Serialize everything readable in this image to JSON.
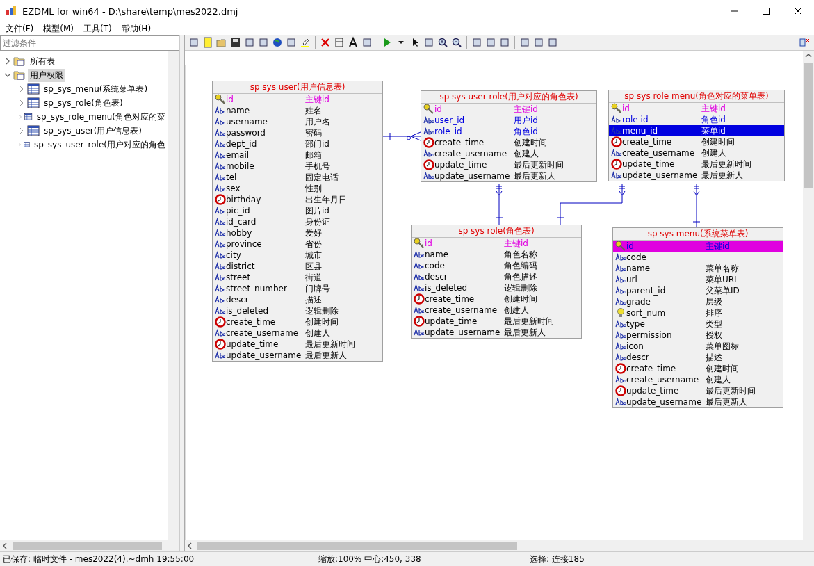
{
  "window": {
    "title": "EZDML for win64 - D:\\share\\temp\\mes2022.dmj"
  },
  "menu": [
    "文件(F)",
    "模型(M)",
    "工具(T)",
    "帮助(H)"
  ],
  "filter": {
    "placeholder": "过滤条件"
  },
  "tree": [
    {
      "label": "所有表",
      "expanded": false,
      "selected": false
    },
    {
      "label": "用户权限",
      "expanded": true,
      "selected": true,
      "children": [
        {
          "label": "sp_sys_menu(系统菜单表)"
        },
        {
          "label": "sp_sys_role(角色表)"
        },
        {
          "label": "sp_sys_role_menu(角色对应的菜"
        },
        {
          "label": "sp_sys_user(用户信息表)"
        },
        {
          "label": "sp_sys_user_role(用户对应的角色"
        }
      ]
    }
  ],
  "tables": [
    {
      "title": "sp sys user(用户信息表)",
      "fields": [
        {
          "kind": "key",
          "name": "id",
          "comment": "主键id",
          "color": "#e000e0",
          "selected": false
        },
        {
          "kind": "text",
          "name": "name",
          "comment": "姓名",
          "selected": false
        },
        {
          "kind": "text",
          "name": "username",
          "comment": "用户名",
          "selected": false
        },
        {
          "kind": "text",
          "name": "password",
          "comment": "密码",
          "selected": false
        },
        {
          "kind": "text",
          "name": "dept_id",
          "comment": "部门id",
          "selected": false
        },
        {
          "kind": "text",
          "name": "email",
          "comment": "邮箱",
          "selected": false
        },
        {
          "kind": "text",
          "name": "mobile",
          "comment": "手机号",
          "selected": false
        },
        {
          "kind": "text",
          "name": "tel",
          "comment": "固定电话",
          "selected": false
        },
        {
          "kind": "text",
          "name": "sex",
          "comment": "性别",
          "selected": false
        },
        {
          "kind": "clock",
          "name": "birthday",
          "comment": "出生年月日",
          "selected": false
        },
        {
          "kind": "text",
          "name": "pic_id",
          "comment": "图片id",
          "selected": false
        },
        {
          "kind": "text",
          "name": "id_card",
          "comment": "身份证",
          "selected": false
        },
        {
          "kind": "text",
          "name": "hobby",
          "comment": "爱好",
          "selected": false
        },
        {
          "kind": "text",
          "name": "province",
          "comment": "省份",
          "selected": false
        },
        {
          "kind": "text",
          "name": "city",
          "comment": "城市",
          "selected": false
        },
        {
          "kind": "text",
          "name": "district",
          "comment": "区县",
          "selected": false
        },
        {
          "kind": "text",
          "name": "street",
          "comment": "街道",
          "selected": false
        },
        {
          "kind": "text",
          "name": "street_number",
          "comment": "门牌号",
          "selected": false
        },
        {
          "kind": "text",
          "name": "descr",
          "comment": "描述",
          "selected": false
        },
        {
          "kind": "text",
          "name": "is_deleted",
          "comment": "逻辑删除",
          "selected": false
        },
        {
          "kind": "clock",
          "name": "create_time",
          "comment": "创建时间",
          "selected": false
        },
        {
          "kind": "text",
          "name": "create_username",
          "comment": "创建人",
          "selected": false
        },
        {
          "kind": "clock",
          "name": "update_time",
          "comment": "最后更新时间",
          "selected": false
        },
        {
          "kind": "text",
          "name": "update_username",
          "comment": "最后更新人",
          "selected": false
        }
      ]
    },
    {
      "title": "sp sys user role(用户对应的角色表)",
      "fields": [
        {
          "kind": "key",
          "name": "id",
          "comment": "主键id",
          "color": "#e000e0",
          "selected": false
        },
        {
          "kind": "text",
          "name": "user_id",
          "comment": "用户id",
          "color": "#0000e0",
          "selected": false
        },
        {
          "kind": "text",
          "name": "role_id",
          "comment": "角色id",
          "color": "#0000e0",
          "selected": false
        },
        {
          "kind": "clock",
          "name": "create_time",
          "comment": "创建时间",
          "selected": false
        },
        {
          "kind": "text",
          "name": "create_username",
          "comment": "创建人",
          "selected": false
        },
        {
          "kind": "clock",
          "name": "update_time",
          "comment": "最后更新时间",
          "selected": false
        },
        {
          "kind": "text",
          "name": "update_username",
          "comment": "最后更新人",
          "selected": false
        }
      ]
    },
    {
      "title": "sp sys role menu(角色对应的菜单表)",
      "fields": [
        {
          "kind": "key",
          "name": "id",
          "comment": "主键id",
          "color": "#e000e0",
          "selected": false
        },
        {
          "kind": "text",
          "name": "role id",
          "comment": "角色id",
          "color": "#0000e0",
          "selected": false
        },
        {
          "kind": "text",
          "name": "menu_id",
          "comment": "菜单id",
          "color": "#0000e0",
          "selected": true
        },
        {
          "kind": "clock",
          "name": "create_time",
          "comment": "创建时间",
          "selected": false
        },
        {
          "kind": "text",
          "name": "create_username",
          "comment": "创建人",
          "selected": false
        },
        {
          "kind": "clock",
          "name": "update_time",
          "comment": "最后更新时间",
          "selected": false
        },
        {
          "kind": "text",
          "name": "update_username",
          "comment": "最后更新人",
          "selected": false
        }
      ]
    },
    {
      "title": "sp sys role(角色表)",
      "fields": [
        {
          "kind": "key",
          "name": "id",
          "comment": "主键id",
          "color": "#e000e0",
          "selected": false
        },
        {
          "kind": "text",
          "name": "name",
          "comment": "角色名称",
          "selected": false
        },
        {
          "kind": "text",
          "name": "code",
          "comment": "角色编码",
          "selected": false
        },
        {
          "kind": "text",
          "name": "descr",
          "comment": "角色描述",
          "selected": false
        },
        {
          "kind": "text",
          "name": "is_deleted",
          "comment": "逻辑删除",
          "selected": false
        },
        {
          "kind": "clock",
          "name": "create_time",
          "comment": "创建时间",
          "selected": false
        },
        {
          "kind": "text",
          "name": "create_username",
          "comment": "创建人",
          "selected": false
        },
        {
          "kind": "clock",
          "name": "update_time",
          "comment": "最后更新时间",
          "selected": false
        },
        {
          "kind": "text",
          "name": "update_username",
          "comment": "最后更新人",
          "selected": false
        }
      ]
    },
    {
      "title": "sp sys menu(系统菜单表)",
      "fields": [
        {
          "kind": "key",
          "name": "id",
          "comment": "主键id",
          "color": "#e000e0",
          "selected": true
        },
        {
          "kind": "text",
          "name": "code",
          "selected": false
        },
        {
          "kind": "text",
          "name": "name",
          "comment": "菜单名称",
          "selected": false
        },
        {
          "kind": "text",
          "name": "url",
          "comment": "菜单URL",
          "selected": false
        },
        {
          "kind": "text",
          "name": "parent_id",
          "comment": "父菜单ID",
          "selected": false
        },
        {
          "kind": "text",
          "name": "grade",
          "comment": "层级",
          "selected": false
        },
        {
          "kind": "bulb",
          "name": "sort_num",
          "comment": "排序",
          "selected": false
        },
        {
          "kind": "text",
          "name": "type",
          "comment": "类型",
          "selected": false
        },
        {
          "kind": "text",
          "name": "permission",
          "comment": "授权",
          "selected": false
        },
        {
          "kind": "text",
          "name": "icon",
          "comment": "菜单图标",
          "selected": false
        },
        {
          "kind": "text",
          "name": "descr",
          "comment": "描述",
          "selected": false
        },
        {
          "kind": "clock",
          "name": "create_time",
          "comment": "创建时间",
          "selected": false
        },
        {
          "kind": "text",
          "name": "create_username",
          "comment": "创建人",
          "selected": false
        },
        {
          "kind": "clock",
          "name": "update_time",
          "comment": "最后更新时间",
          "selected": false
        },
        {
          "kind": "text",
          "name": "update_username",
          "comment": "最后更新人",
          "selected": false
        }
      ]
    }
  ],
  "status_bar": [
    "已保存: 临时文件 - mes2022(4).~dmh 19:55:00",
    "缩放:100% 中心:450, 338",
    "选择: 连接185"
  ]
}
